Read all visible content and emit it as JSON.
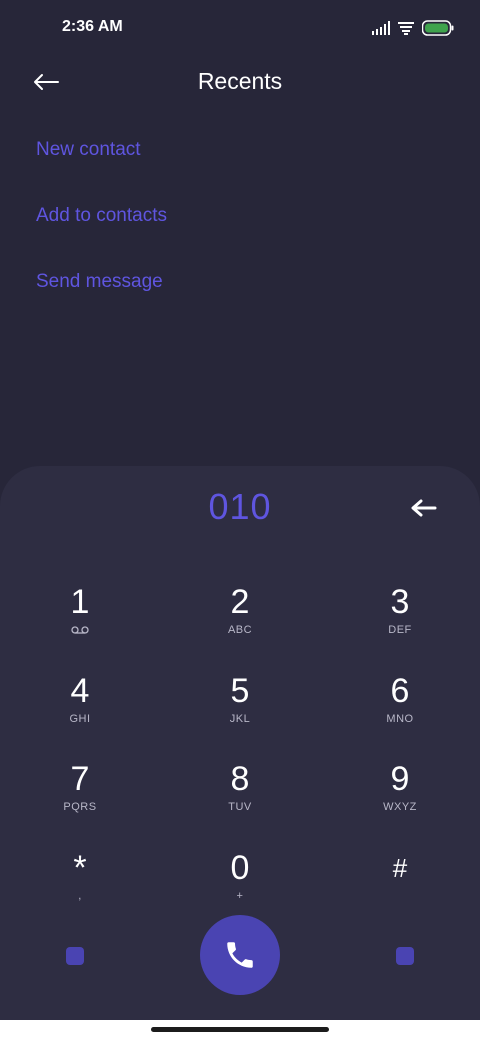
{
  "status_bar": {
    "time": "2:36 AM",
    "icons": [
      "signal-icon",
      "wifi-icon",
      "battery-icon"
    ],
    "battery_color": "#3fa34d"
  },
  "header": {
    "title": "Recents",
    "back_icon": "arrow-left-icon"
  },
  "actions": [
    {
      "label": "New contact"
    },
    {
      "label": "Add to contacts"
    },
    {
      "label": "Send message"
    }
  ],
  "dialpad": {
    "number": "010",
    "backspace_icon": "backspace-arrow-icon",
    "keys": [
      {
        "digit": "1",
        "letters": "",
        "icon": "voicemail-icon"
      },
      {
        "digit": "2",
        "letters": "ABC"
      },
      {
        "digit": "3",
        "letters": "DEF"
      },
      {
        "digit": "4",
        "letters": "GHI"
      },
      {
        "digit": "5",
        "letters": "JKL"
      },
      {
        "digit": "6",
        "letters": "MNO"
      },
      {
        "digit": "7",
        "letters": "PQRS"
      },
      {
        "digit": "8",
        "letters": "TUV"
      },
      {
        "digit": "9",
        "letters": "WXYZ"
      },
      {
        "digit": "*",
        "letters": ","
      },
      {
        "digit": "0",
        "letters": "+"
      },
      {
        "digit": "#",
        "letters": ""
      }
    ],
    "call_icon": "phone-icon"
  },
  "colors": {
    "background": "#272639",
    "dialpad_background": "#2e2d42",
    "accent": "#5f55e0",
    "call_button": "#4a44b2"
  }
}
